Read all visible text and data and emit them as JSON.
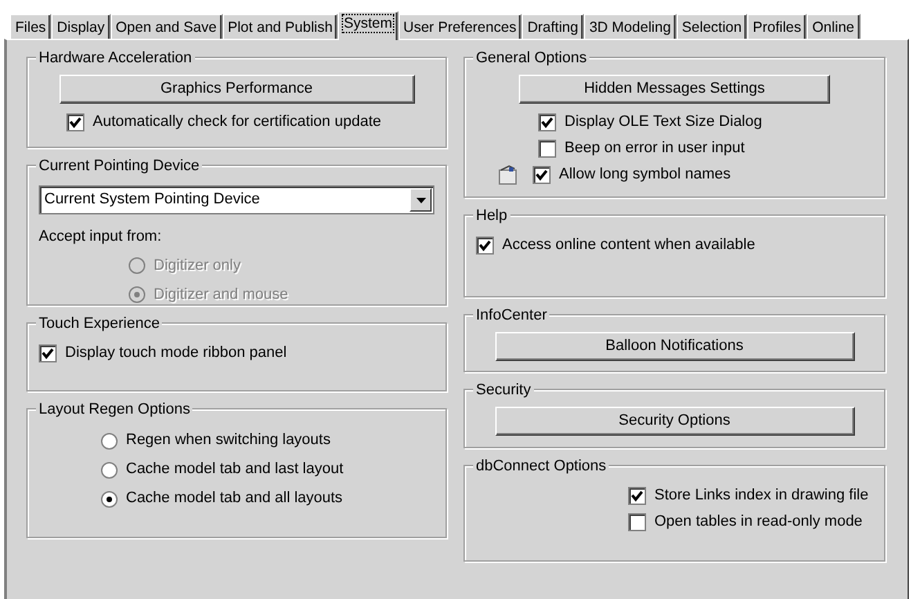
{
  "tabs": [
    {
      "label": "Files",
      "selected": false
    },
    {
      "label": "Display",
      "selected": false
    },
    {
      "label": "Open and Save",
      "selected": false
    },
    {
      "label": "Plot and Publish",
      "selected": false
    },
    {
      "label": "System",
      "selected": true
    },
    {
      "label": "User Preferences",
      "selected": false
    },
    {
      "label": "Drafting",
      "selected": false
    },
    {
      "label": "3D Modeling",
      "selected": false
    },
    {
      "label": "Selection",
      "selected": false
    },
    {
      "label": "Profiles",
      "selected": false
    },
    {
      "label": "Online",
      "selected": false
    }
  ],
  "left_column": [
    {
      "title": "Hardware Acceleration",
      "items": [
        {
          "kind": "button",
          "label": "Graphics Performance"
        },
        {
          "kind": "checkbox",
          "label": "Automatically check for certification update",
          "checked": true
        }
      ]
    },
    {
      "title": "Current Pointing Device",
      "items": [
        {
          "kind": "dropdown",
          "value": "Current System Pointing Device"
        },
        {
          "kind": "label",
          "label": "Accept input from:"
        },
        {
          "kind": "radio",
          "label": "Digitizer only",
          "selected": false,
          "disabled": true
        },
        {
          "kind": "radio",
          "label": "Digitizer and mouse",
          "selected": true,
          "disabled": true
        }
      ]
    },
    {
      "title": "Touch Experience",
      "items": [
        {
          "kind": "checkbox",
          "label": "Display touch mode ribbon panel",
          "checked": true
        }
      ]
    },
    {
      "title": "Layout Regen Options",
      "items": [
        {
          "kind": "radio",
          "label": "Regen when switching layouts",
          "selected": false,
          "disabled": false
        },
        {
          "kind": "radio",
          "label": "Cache model tab and last layout",
          "selected": false,
          "disabled": false
        },
        {
          "kind": "radio",
          "label": "Cache model tab and all layouts",
          "selected": true,
          "disabled": false
        }
      ]
    }
  ],
  "right_column": [
    {
      "title": "General Options",
      "items": [
        {
          "kind": "button",
          "label": "Hidden Messages Settings"
        },
        {
          "kind": "checkbox",
          "label": "Display OLE Text Size Dialog",
          "checked": true
        },
        {
          "kind": "checkbox",
          "label": "Beep on error in user input",
          "checked": false
        },
        {
          "kind": "checkbox",
          "label": "Allow long symbol names",
          "checked": true,
          "drawing_icon": true
        }
      ]
    },
    {
      "title": "Help",
      "items": [
        {
          "kind": "checkbox",
          "label": "Access online content when available",
          "checked": true
        }
      ]
    },
    {
      "title": "InfoCenter",
      "items": [
        {
          "kind": "button",
          "label": "Balloon Notifications"
        }
      ]
    },
    {
      "title": "Security",
      "items": [
        {
          "kind": "button",
          "label": "Security Options"
        }
      ]
    },
    {
      "title": "dbConnect Options",
      "items": [
        {
          "kind": "checkbox",
          "label": "Store Links index in drawing file",
          "checked": true
        },
        {
          "kind": "checkbox",
          "label": "Open tables in read-only mode",
          "checked": false
        }
      ]
    }
  ]
}
